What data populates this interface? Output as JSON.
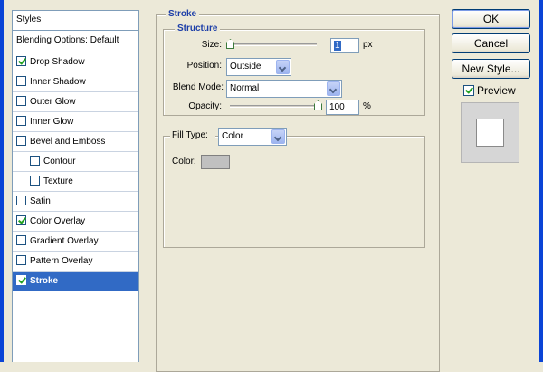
{
  "styles_list": {
    "header": "Styles",
    "blending_options": "Blending Options: Default",
    "items": [
      {
        "label": "Drop Shadow",
        "checked": true
      },
      {
        "label": "Inner Shadow",
        "checked": false
      },
      {
        "label": "Outer Glow",
        "checked": false
      },
      {
        "label": "Inner Glow",
        "checked": false
      },
      {
        "label": "Bevel and Emboss",
        "checked": false
      },
      {
        "label": "Contour",
        "checked": false
      },
      {
        "label": "Texture",
        "checked": false
      },
      {
        "label": "Satin",
        "checked": false
      },
      {
        "label": "Color Overlay",
        "checked": true
      },
      {
        "label": "Gradient Overlay",
        "checked": false
      },
      {
        "label": "Pattern Overlay",
        "checked": false
      },
      {
        "label": "Stroke",
        "checked": true,
        "selected": true
      }
    ]
  },
  "stroke": {
    "title": "Stroke",
    "structure": {
      "title": "Structure",
      "size_label": "Size:",
      "size_value": "1",
      "size_unit": "px",
      "position_label": "Position:",
      "position_value": "Outside",
      "blend_mode_label": "Blend Mode:",
      "blend_mode_value": "Normal",
      "opacity_label": "Opacity:",
      "opacity_value": "100",
      "opacity_unit": "%"
    },
    "fill": {
      "fill_type_label": "Fill Type:",
      "fill_type_value": "Color",
      "color_label": "Color:",
      "color_value": "#c0c0c0"
    }
  },
  "buttons": {
    "ok": "OK",
    "cancel": "Cancel",
    "new_style": "New Style..."
  },
  "preview": {
    "label": "Preview",
    "checked": true
  }
}
